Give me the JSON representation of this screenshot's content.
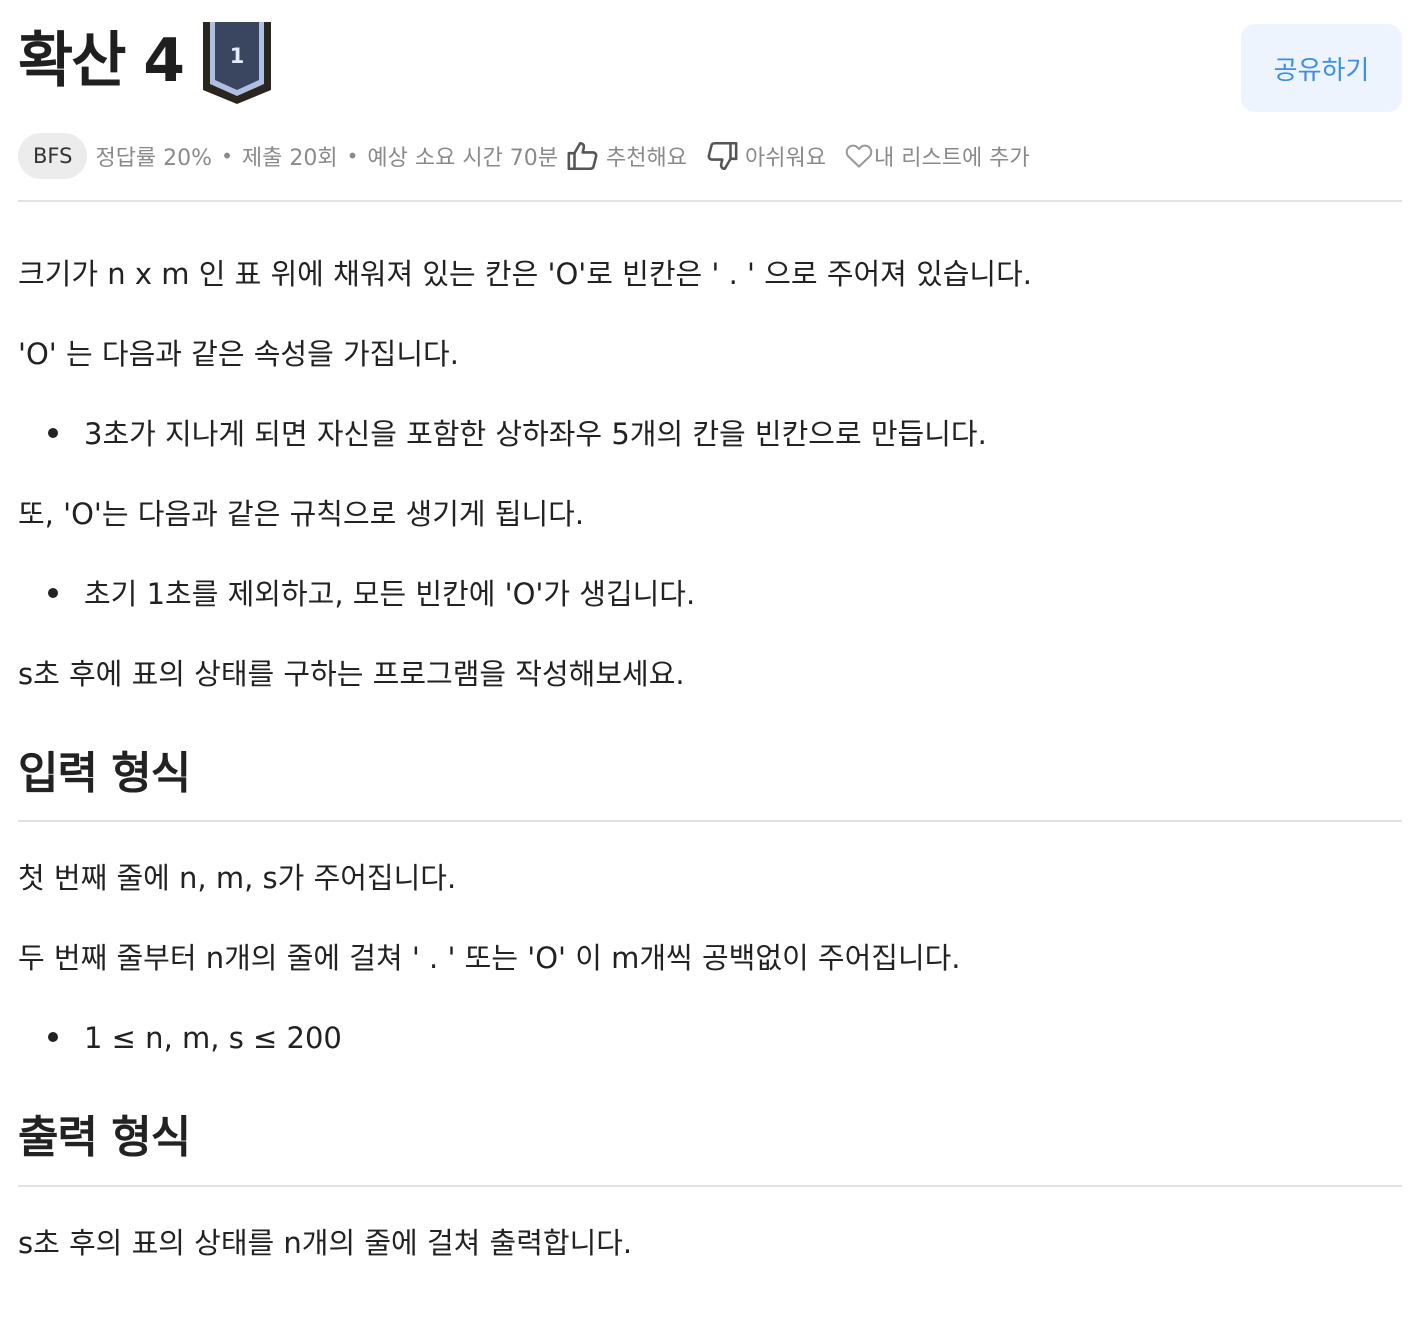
{
  "problem": {
    "title": "확산 4",
    "level": "1",
    "share_label": "공유하기"
  },
  "meta": {
    "tag": "BFS",
    "accuracy": "정답률 20%",
    "submissions": "제출 20회",
    "expected_time": "예상 소요 시간 70분",
    "like_label": "추천해요",
    "dislike_label": "아쉬워요",
    "add_list_label": "내 리스트에 추가",
    "separator": "•"
  },
  "description": {
    "p1": "크기가 n x m 인 표 위에 채워져 있는 칸은 'O'로 빈칸은 ' . ' 으로 주어져 있습니다.",
    "p2": "'O' 는 다음과 같은 속성을 가집니다.",
    "b1": "3초가 지나게 되면 자신을 포함한 상하좌우 5개의 칸을 빈칸으로 만듭니다.",
    "p3": "또, 'O'는 다음과 같은 규칙으로 생기게 됩니다.",
    "b2": "초기 1초를 제외하고, 모든 빈칸에 'O'가 생깁니다.",
    "p4": "s초 후에 표의 상태를 구하는 프로그램을 작성해보세요."
  },
  "input_section": {
    "heading": "입력 형식",
    "p1": "첫 번째 줄에 n, m, s가 주어집니다.",
    "p2": "두 번째 줄부터 n개의 줄에 걸쳐 ' . ' 또는 'O' 이 m개씩 공백없이 주어집니다.",
    "b1": "1 ≤ n, m, s ≤ 200"
  },
  "output_section": {
    "heading": "출력 형식",
    "p1": "s초 후의 표의 상태를 n개의 줄에 걸쳐 출력합니다."
  },
  "colors": {
    "accent": "#3b8fe6",
    "share_bg": "#edf4fd",
    "badge_dark": "#2f3a52",
    "badge_light": "#aebfe0"
  },
  "icons": [
    "level-badge-icon",
    "thumbs-up-icon",
    "thumbs-down-icon",
    "heart-icon"
  ]
}
